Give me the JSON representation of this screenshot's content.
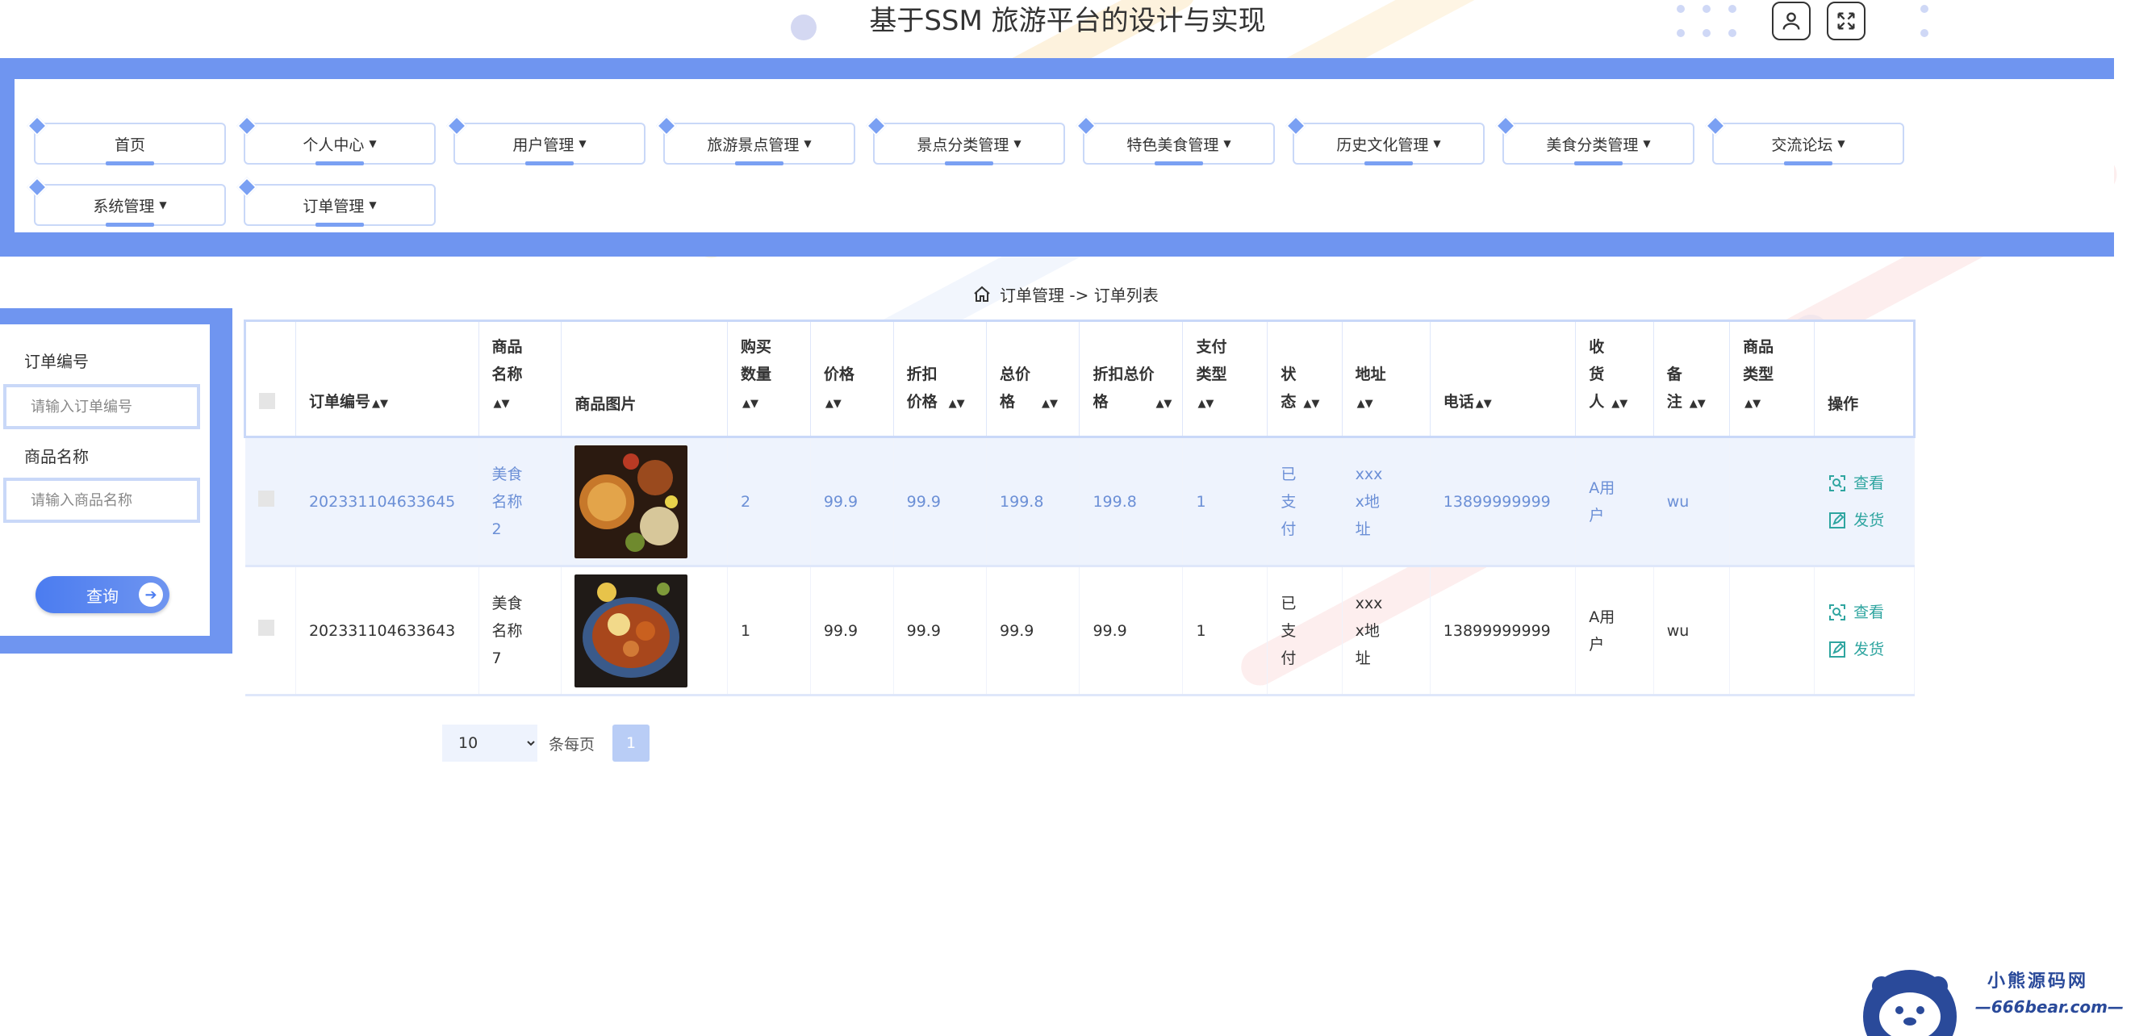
{
  "header": {
    "title": "基于SSM 旅游平台的设计与实现",
    "user_icon": "user-icon",
    "fullscreen_icon": "fullscreen-icon"
  },
  "nav": {
    "items": [
      {
        "label": "首页",
        "dropdown": false
      },
      {
        "label": "个人中心",
        "dropdown": true
      },
      {
        "label": "用户管理",
        "dropdown": true
      },
      {
        "label": "旅游景点管理",
        "dropdown": true
      },
      {
        "label": "景点分类管理",
        "dropdown": true
      },
      {
        "label": "特色美食管理",
        "dropdown": true
      },
      {
        "label": "历史文化管理",
        "dropdown": true
      },
      {
        "label": "美食分类管理",
        "dropdown": true
      },
      {
        "label": "交流论坛",
        "dropdown": true
      },
      {
        "label": "系统管理",
        "dropdown": true
      },
      {
        "label": "订单管理",
        "dropdown": true
      }
    ]
  },
  "breadcrumb": {
    "icon": "home-icon",
    "text": "订单管理 -> 订单列表"
  },
  "search": {
    "order_no_label": "订单编号",
    "order_no_placeholder": "请输入订单编号",
    "product_name_label": "商品名称",
    "product_name_placeholder": "请输入商品名称",
    "query_label": "查询"
  },
  "table": {
    "columns": [
      {
        "label": "",
        "sortable": false
      },
      {
        "label": "订单编号",
        "sortable": true
      },
      {
        "label": "商品名称",
        "sortable": true
      },
      {
        "label": "商品图片",
        "sortable": false
      },
      {
        "label": "购买数量",
        "sortable": true
      },
      {
        "label": "价格",
        "sortable": true
      },
      {
        "label": "折扣价格",
        "sortable": true
      },
      {
        "label": "总价格",
        "sortable": true
      },
      {
        "label": "折扣总价格",
        "sortable": true
      },
      {
        "label": "支付类型",
        "sortable": true
      },
      {
        "label": "状态",
        "sortable": true
      },
      {
        "label": "地址",
        "sortable": true
      },
      {
        "label": "电话",
        "sortable": true
      },
      {
        "label": "收货人",
        "sortable": true
      },
      {
        "label": "备注",
        "sortable": true
      },
      {
        "label": "商品类型",
        "sortable": true
      },
      {
        "label": "操作",
        "sortable": false
      }
    ],
    "rows": [
      {
        "order_no": "202331104633645",
        "product_name": "美食名称2",
        "quantity": "2",
        "price": "99.9",
        "discount_price": "99.9",
        "total_price": "199.8",
        "discount_total": "199.8",
        "pay_type": "1",
        "status": "已支付",
        "address": "xxxx地址",
        "phone": "13899999999",
        "receiver": "A用户",
        "remark": "wu",
        "product_type": "",
        "view_label": "查看",
        "ship_label": "发货"
      },
      {
        "order_no": "202331104633643",
        "product_name": "美食名称7",
        "quantity": "1",
        "price": "99.9",
        "discount_price": "99.9",
        "total_price": "99.9",
        "discount_total": "99.9",
        "pay_type": "1",
        "status": "已支付",
        "address": "xxxx地址",
        "phone": "13899999999",
        "receiver": "A用户",
        "remark": "wu",
        "product_type": "",
        "view_label": "查看",
        "ship_label": "发货"
      }
    ]
  },
  "pagination": {
    "page_size": "10",
    "per_page_label": "条每页",
    "current_page": "1"
  },
  "watermark": {
    "line1": "小熊源码网",
    "line2": "—666bear.com—"
  },
  "colors": {
    "accent": "#6f95f0",
    "link_text": "#6b8fd6",
    "action": "#2fa5a0",
    "selected_row": "#eef3fd"
  }
}
